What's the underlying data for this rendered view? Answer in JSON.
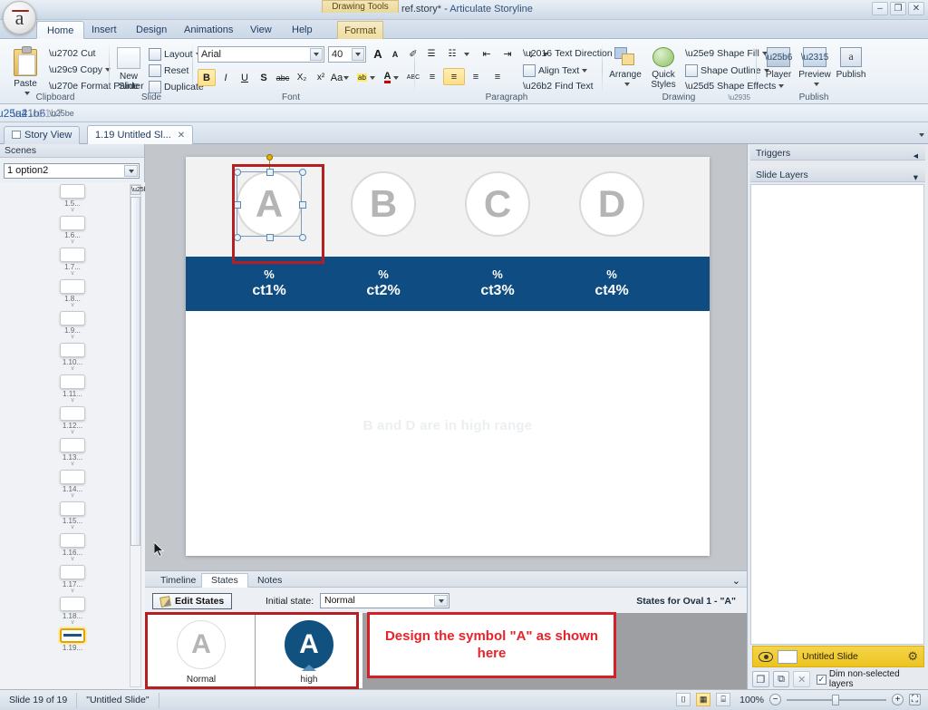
{
  "window": {
    "doc_title": "ref.story*",
    "separator": "-",
    "app_name": "Articulate Storyline",
    "contextual_group": "Drawing Tools",
    "minimize": "–",
    "restore": "❐",
    "close": "✕"
  },
  "ribbon": {
    "tabs": [
      {
        "label": "Home",
        "active": true
      },
      {
        "label": "Insert",
        "active": false
      },
      {
        "label": "Design",
        "active": false
      },
      {
        "label": "Animations",
        "active": false
      },
      {
        "label": "View",
        "active": false
      },
      {
        "label": "Help",
        "active": false
      },
      {
        "label": "Format",
        "active": false,
        "contextual": true
      }
    ],
    "clipboard": {
      "group_label": "Clipboard",
      "paste": "Paste",
      "cut": "Cut",
      "copy": "Copy",
      "format_painter": "Format Painter"
    },
    "slide": {
      "group_label": "Slide",
      "new_slide": "New\nSlide",
      "new_slide_l1": "New",
      "new_slide_l2": "Slide",
      "layout": "Layout",
      "reset": "Reset",
      "duplicate": "Duplicate"
    },
    "font": {
      "group_label": "Font",
      "family": "Arial",
      "size": "40",
      "bold": "B",
      "italic": "I",
      "underline": "U",
      "shadow": "S",
      "strikethrough": "abc",
      "subscript": "X₂",
      "superscript": "x²",
      "change_case": "Aa",
      "grow_font": "A",
      "shrink_font": "A",
      "clear_formatting": "✐",
      "highlight": "ab",
      "font_color": "A",
      "spelling": "ABC"
    },
    "paragraph": {
      "group_label": "Paragraph",
      "bullets": "☰",
      "numbering": "☷",
      "decrease_indent": "⇤",
      "increase_indent": "⇥",
      "line_spacing": "↕",
      "text_direction": "Text Direction",
      "align_text": "Align Text",
      "find_text": "Find Text",
      "align_left": "≡",
      "align_center": "≡",
      "align_right": "≡",
      "justify": "≡"
    },
    "drawing": {
      "group_label": "Drawing",
      "arrange": "Arrange",
      "quick_styles_l1": "Quick",
      "quick_styles_l2": "Styles",
      "shape_fill": "Shape Fill",
      "shape_outline": "Shape Outline",
      "shape_effects": "Shape Effects"
    },
    "publish": {
      "group_label": "Publish",
      "player": "Player",
      "preview": "Preview",
      "publish": "Publish"
    }
  },
  "qat": {
    "save": "💾",
    "undo": "↶",
    "redo": "↷",
    "customize": "▾"
  },
  "doc_tabs": [
    {
      "label": "Story View",
      "active": false,
      "closable": false
    },
    {
      "label": "1.19 Untitled Sl...",
      "active": true,
      "closable": true,
      "close": "✕"
    }
  ],
  "left_panel": {
    "header": "Scenes",
    "scene_selected": "1 option2",
    "thumbnails": [
      {
        "label": "1.5..."
      },
      {
        "label": "1.6..."
      },
      {
        "label": "1.7..."
      },
      {
        "label": "1.8..."
      },
      {
        "label": "1.9..."
      },
      {
        "label": "1.10..."
      },
      {
        "label": "1.11..."
      },
      {
        "label": "1.12..."
      },
      {
        "label": "1.13..."
      },
      {
        "label": "1.14..."
      },
      {
        "label": "1.15..."
      },
      {
        "label": "1.16..."
      },
      {
        "label": "1.17..."
      },
      {
        "label": "1.18..."
      },
      {
        "label": "1.19...",
        "selected": true
      }
    ],
    "connector": "∨"
  },
  "slide": {
    "ovals": [
      {
        "letter": "A",
        "selected": true
      },
      {
        "letter": "B",
        "selected": false
      },
      {
        "letter": "C",
        "selected": false
      },
      {
        "letter": "D",
        "selected": false
      }
    ],
    "percent_symbol": "%",
    "percent_values": [
      "ct1%",
      "ct2%",
      "ct3%",
      "ct4%"
    ],
    "faint_text": "B and D are in high range",
    "bar_color": "#0f4c81"
  },
  "states_panel": {
    "tabs": [
      {
        "label": "Timeline",
        "active": false
      },
      {
        "label": "States",
        "active": true
      },
      {
        "label": "Notes",
        "active": false
      }
    ],
    "collapse_icon": "⌄",
    "edit_states": "Edit States",
    "initial_state_label": "Initial state:",
    "initial_state_value": "Normal",
    "states_for": "States for Oval 1 - \"A\"",
    "states": [
      {
        "name": "Normal",
        "letter": "A",
        "style": "normal"
      },
      {
        "name": "high",
        "letter": "A",
        "style": "high"
      }
    ],
    "annotation": "Design the symbol \"A\" as shown here",
    "annotation_color": "#e8232a"
  },
  "right_panel": {
    "triggers_header": "Triggers",
    "triggers_chevron": "◂",
    "slide_layers_header": "Slide Layers",
    "slide_layers_chevron": "▾",
    "layer_name": "Untitled Slide",
    "layer_gear": "⚙",
    "new_layer": "❐",
    "duplicate_layer": "⧉",
    "delete_layer": "✕",
    "dim_label": "Dim non-selected layers",
    "dim_checked": "✓"
  },
  "status_bar": {
    "slide_count": "Slide 19 of 19",
    "slide_name": "\"Untitled Slide\"",
    "zoom": "100%",
    "view_normal": "▦",
    "view_grid": "⌷",
    "view_notes": "⌸",
    "zoom_out": "−",
    "zoom_in": "+",
    "fit": "⛶"
  }
}
